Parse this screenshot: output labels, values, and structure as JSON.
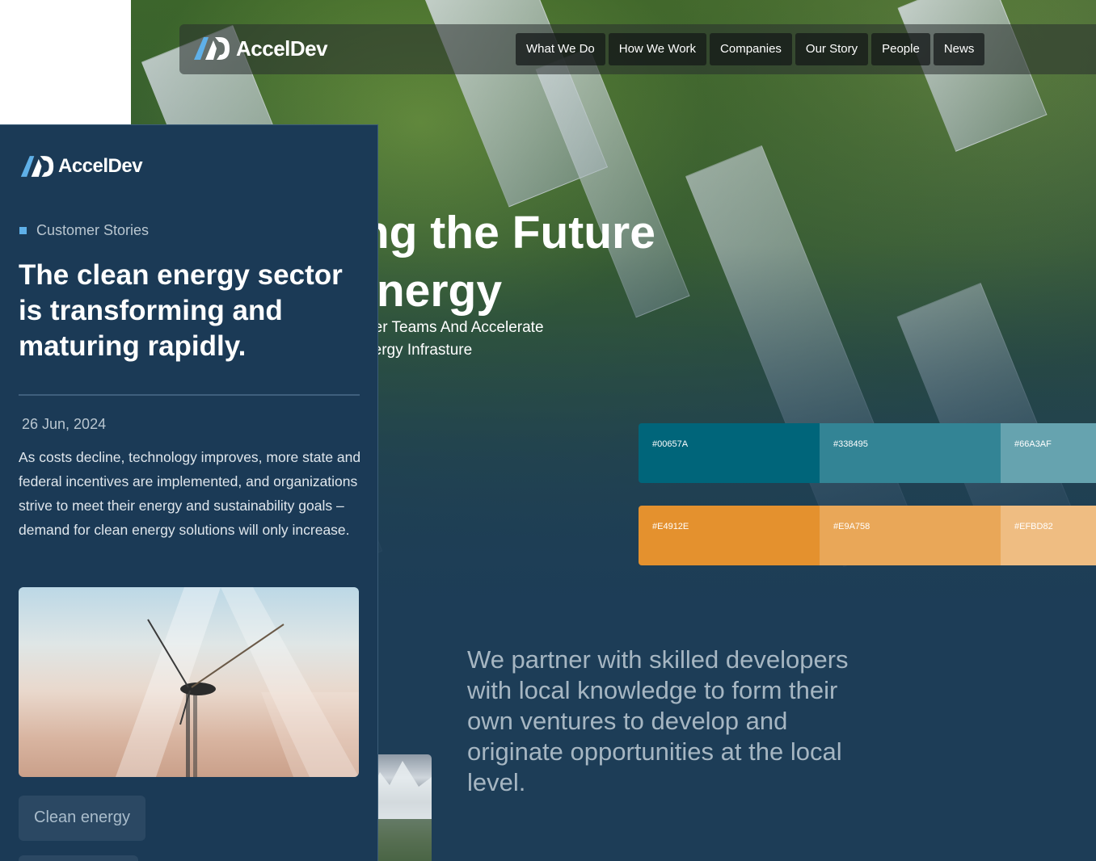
{
  "site": {
    "brand": "AccelDev",
    "nav": [
      "What We Do",
      "How We Work",
      "Companies",
      "Our Story",
      "People",
      "News"
    ],
    "hero": {
      "title_line1": "ting the Future",
      "title_line2": " Energy",
      "sub_line1": "mpower Teams And Accelerate",
      "sub_line2": "an Energy Infrasture"
    },
    "palette": {
      "row1": [
        {
          "label": "#00657A",
          "color": "#00657A"
        },
        {
          "label": "#338495",
          "color": "#338495"
        },
        {
          "label": "#66A3AF",
          "color": "#66A3AF"
        }
      ],
      "row2": [
        {
          "label": "#E4912E",
          "color": "#E4912E"
        },
        {
          "label": "#E9A758",
          "color": "#E9A758"
        },
        {
          "label": "#EFBD82",
          "color": "#EFBD82"
        }
      ]
    },
    "partner_text": "We partner with skilled developers with local knowledge to form their own ventures to develop and originate opportunities at the local level."
  },
  "card": {
    "brand": "AccelDev",
    "category": "Customer Stories",
    "title": "The clean energy sector is transforming and maturing rapidly.",
    "date": "26 Jun, 2024",
    "body": "As costs decline, technology improves, more state and federal incentives are implemented, and organizations strive to meet their energy and sustainability goals – demand for clean energy solutions will only increase.",
    "tag": "Clean energy"
  },
  "colors": {
    "card_bg": "#1b3a56",
    "accent_square": "#5fb0e8"
  }
}
